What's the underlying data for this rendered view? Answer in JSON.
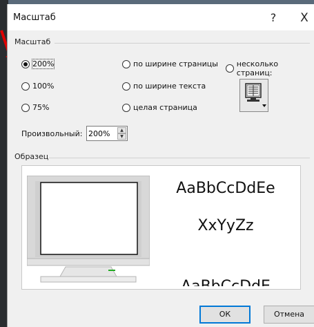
{
  "dialog": {
    "title": "Масштаб",
    "help_symbol": "?",
    "close_symbol": "X"
  },
  "zoom_group": {
    "label": "Масштаб",
    "options": [
      {
        "label": "200%",
        "selected": true
      },
      {
        "label": "100%",
        "selected": false
      },
      {
        "label": "75%",
        "selected": false
      },
      {
        "label": "по ширине страницы",
        "selected": false
      },
      {
        "label": "по ширине текста",
        "selected": false
      },
      {
        "label": "целая страница",
        "selected": false
      },
      {
        "label": "несколько страниц:",
        "selected": false
      }
    ],
    "custom_label": "Произвольный:",
    "custom_value": "200%"
  },
  "preview_group": {
    "label": "Образец",
    "sample_lines": [
      "AaBbCcDdEe",
      "XxYyZz",
      "AaBbCcDdE"
    ]
  },
  "buttons": {
    "ok": "ОК",
    "cancel": "Отмена"
  },
  "icons": {
    "pages": "multi-page-monitor-icon",
    "monitor": "monitor-preview-icon"
  }
}
